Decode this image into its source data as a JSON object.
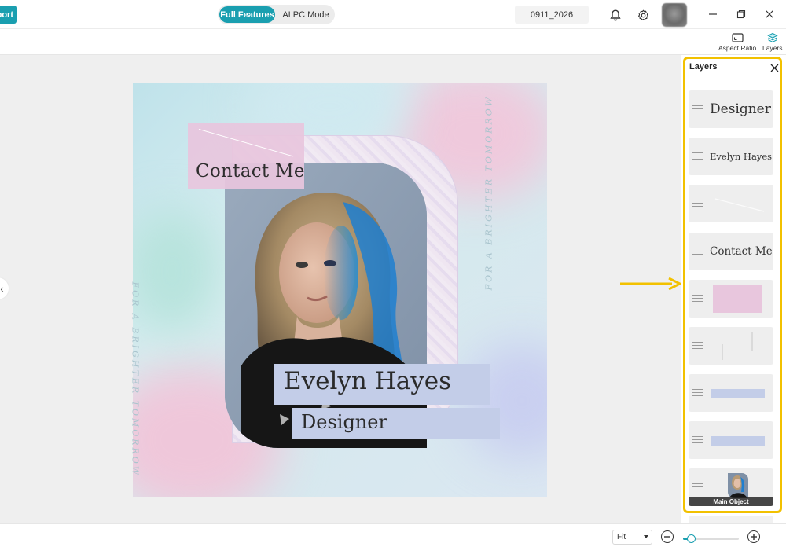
{
  "topbar": {
    "export_label": "port",
    "mode_full_label": "Full Features",
    "mode_ai_label": "AI PC Mode",
    "project_name": "0911_2026"
  },
  "toolbar": {
    "aspect_ratio_label": "Aspect Ratio",
    "layers_label": "Layers"
  },
  "canvas": {
    "contact_text": "Contact Me",
    "name_text": "Evelyn Hayes",
    "role_text": "Designer",
    "vertical_text_left": "FOR A BRIGHTER TOMORROW",
    "vertical_text_right": "FOR A BRIGHTER TOMORROW"
  },
  "layers_panel": {
    "title": "Layers",
    "items": [
      {
        "type": "text",
        "label": "Designer"
      },
      {
        "type": "text",
        "label": "Evelyn Hayes"
      },
      {
        "type": "line",
        "label": ""
      },
      {
        "type": "text",
        "label": "Contact Me"
      },
      {
        "type": "pink-rect",
        "label": ""
      },
      {
        "type": "lines",
        "label": ""
      },
      {
        "type": "blue-rect",
        "label": ""
      },
      {
        "type": "blue-rect",
        "label": ""
      },
      {
        "type": "photo",
        "label": "Main Object"
      }
    ]
  },
  "bottombar": {
    "zoom_mode": "Fit",
    "zoom_level": 0.14
  },
  "colors": {
    "accent": "#1a9fb0",
    "highlight": "#f2c100"
  }
}
